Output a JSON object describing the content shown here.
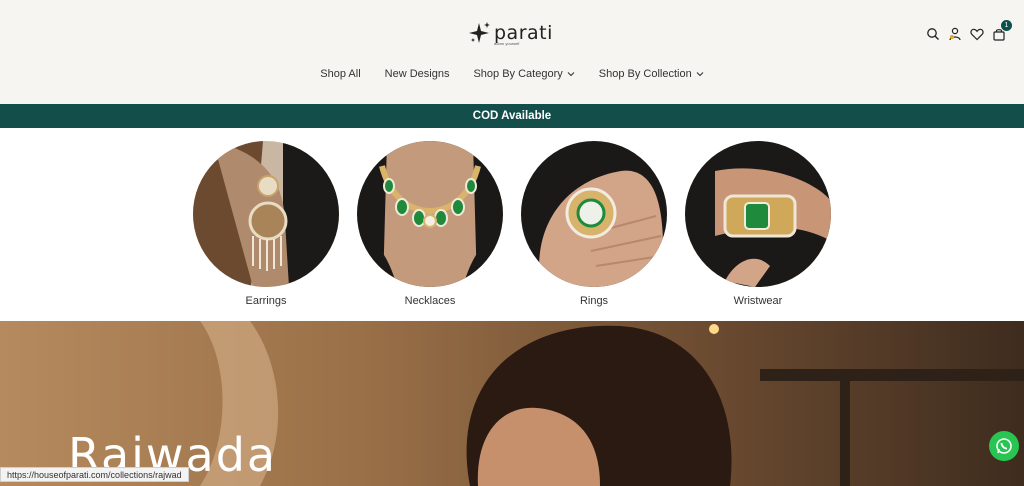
{
  "brand": {
    "name": "parati",
    "tagline": "adorn yourself"
  },
  "nav": [
    {
      "label": "Shop All",
      "dropdown": false
    },
    {
      "label": "New Designs",
      "dropdown": false
    },
    {
      "label": "Shop By Category",
      "dropdown": true
    },
    {
      "label": "Shop By Collection",
      "dropdown": true
    }
  ],
  "header_icons": [
    "search-icon",
    "account-icon",
    "wishlist-icon",
    "cart-icon"
  ],
  "cart": {
    "count": "1"
  },
  "banner": {
    "text": "COD Available"
  },
  "categories": [
    {
      "label": "Earrings"
    },
    {
      "label": "Necklaces"
    },
    {
      "label": "Rings"
    },
    {
      "label": "Wristwear"
    }
  ],
  "hero": {
    "title": "Rajwada"
  },
  "status_bar": {
    "url": "https://houseofparati.com/collections/rajwad"
  },
  "colors": {
    "accent": "#134e4a",
    "background": "#f7f5f1",
    "whatsapp": "#29c553"
  }
}
